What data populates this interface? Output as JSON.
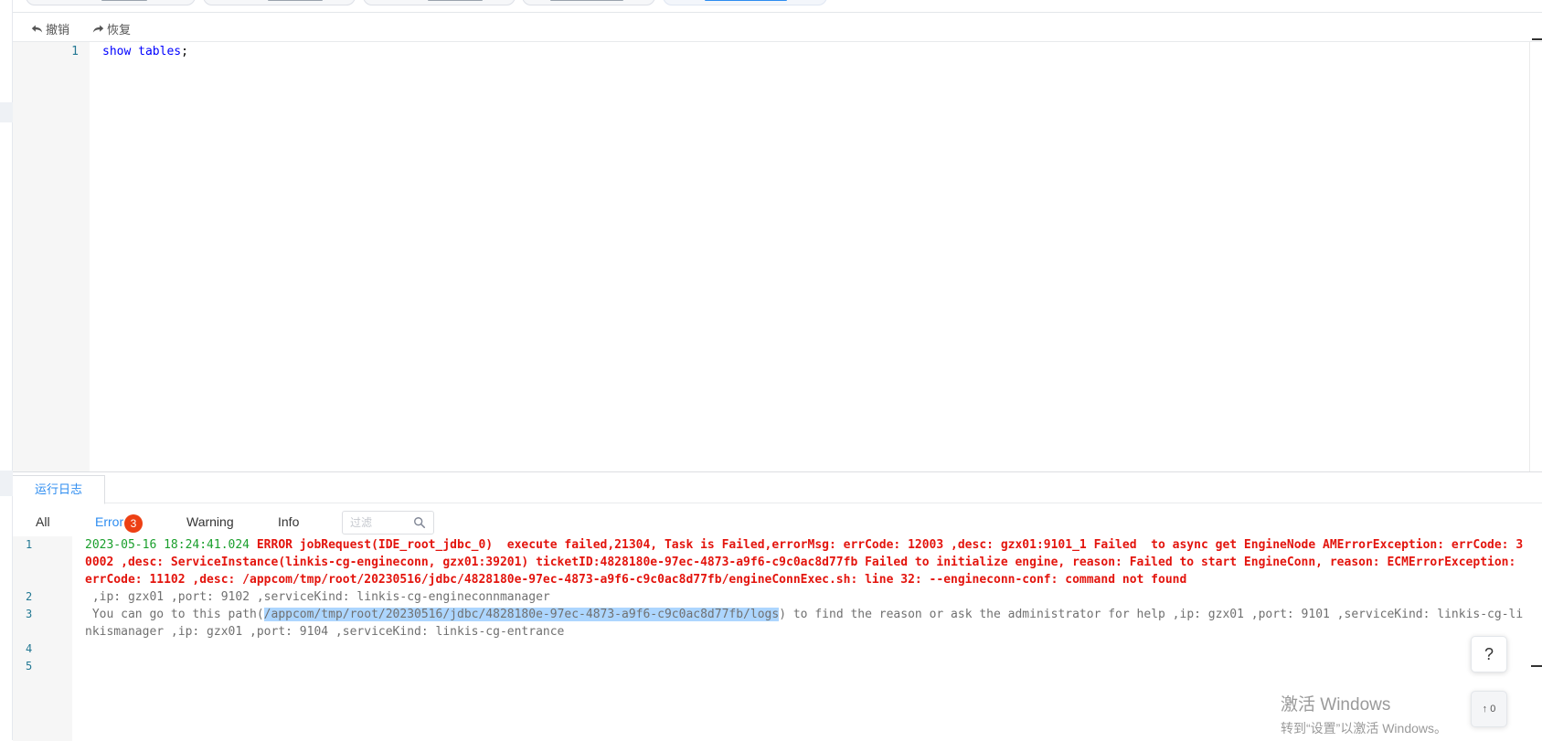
{
  "toolbar": {
    "undo_label": "撤销",
    "redo_label": "恢复"
  },
  "editor": {
    "lines": [
      {
        "number": "1",
        "keyword": "show",
        "rest_keyword": "tables",
        "rest": ";"
      }
    ]
  },
  "log_panel": {
    "tab_label": "运行日志",
    "filters": {
      "all": "All",
      "error": "Error",
      "error_count": "3",
      "warning": "Warning",
      "info": "Info",
      "search_placeholder": "过滤"
    },
    "lines": [
      {
        "number": "1",
        "timestamp": "2023-05-16 18:24:41.024",
        "text": "ERROR jobRequest(IDE_root_jdbc_0)  execute failed,21304, Task is Failed,errorMsg: errCode: 12003 ,desc: gzx01:9101_1 Failed  to async get EngineNode AMErrorException: errCode: 30002 ,desc: ServiceInstance(linkis-cg-engineconn, gzx01:39201) ticketID:4828180e-97ec-4873-a9f6-c9c0ac8d77fb Failed to initialize engine, reason: Failed to start EngineConn, reason: ECMErrorException: errCode: 11102 ,desc: /appcom/tmp/root/20230516/jdbc/4828180e-97ec-4873-a9f6-c9c0ac8d77fb/engineConnExec.sh: line 32: --engineconn-conf: command not found"
      },
      {
        "number": "2",
        "text": " ,ip: gzx01 ,port: 9102 ,serviceKind: linkis-cg-engineconnmanager"
      },
      {
        "number": "3",
        "prefix": " You can go to this path(",
        "selected": "/appcom/tmp/root/20230516/jdbc/4828180e-97ec-4873-a9f6-c9c0ac8d77fb/logs",
        "suffix": ") to find the reason or ask the administrator for help ,ip: gzx01 ,port: 9101 ,serviceKind: linkis-cg-linkismanager ,ip: gzx01 ,port: 9104 ,serviceKind: linkis-cg-entrance"
      },
      {
        "number": "4",
        "text": ""
      },
      {
        "number": "5",
        "text": ""
      }
    ]
  },
  "help_button": {
    "label": "?"
  },
  "float_button": {
    "label": "↑ 0"
  },
  "watermark": {
    "line1": "激活 Windows",
    "line2": "转到“设置”以激活 Windows。"
  }
}
